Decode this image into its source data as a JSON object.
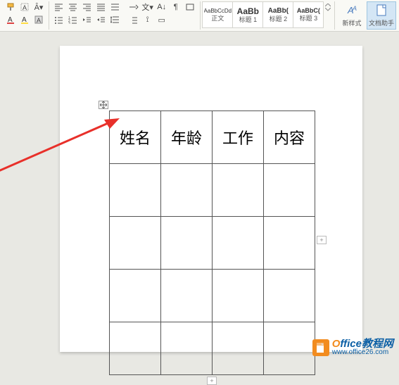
{
  "styles": [
    {
      "preview": "AaBbCcDd",
      "label": "正文",
      "weight": "normal",
      "size": "8px"
    },
    {
      "preview": "AaBb",
      "label": "标题 1",
      "weight": "bold",
      "size": "12px"
    },
    {
      "preview": "AaBb(",
      "label": "标题 2",
      "weight": "bold",
      "size": "10px"
    },
    {
      "preview": "AaBbC(",
      "label": "标题 3",
      "weight": "bold",
      "size": "9px"
    }
  ],
  "new_style_label": "新样式",
  "doc_helper_label": "文档助手",
  "table": {
    "headers": [
      "姓名",
      "年龄",
      "工作",
      "内容"
    ],
    "rows": 5,
    "cols": 4
  },
  "watermark": {
    "title_first": "O",
    "title_rest": "ffice教程网",
    "url": "www.office26.com"
  }
}
